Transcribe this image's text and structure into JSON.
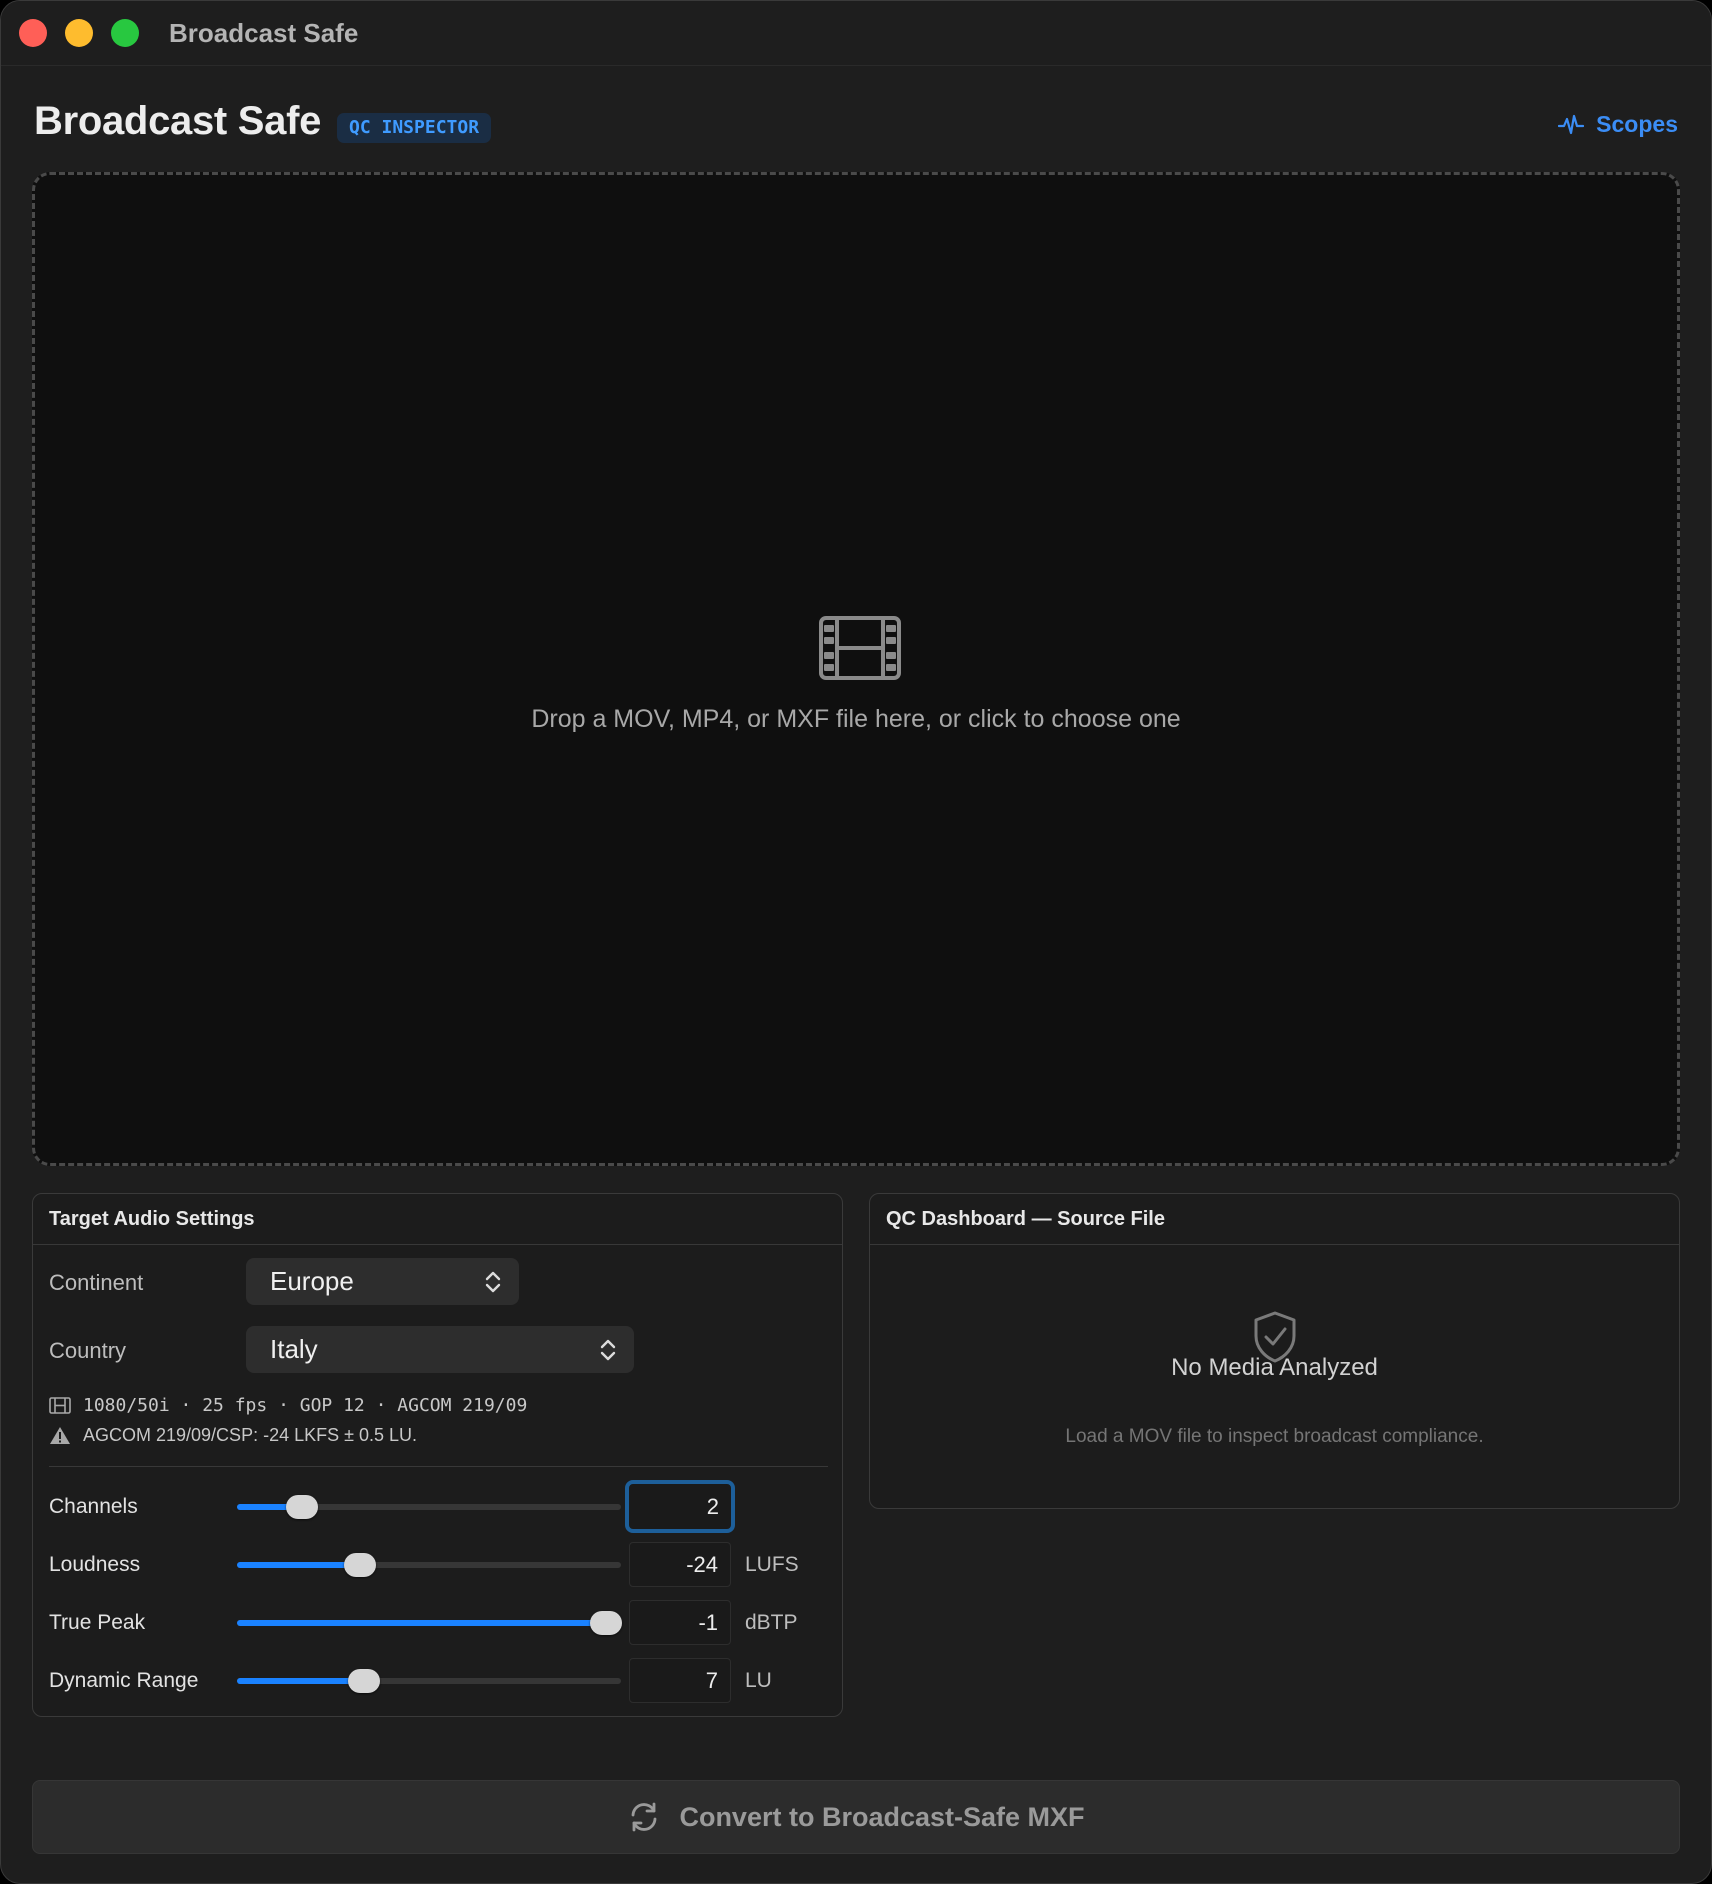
{
  "window": {
    "title": "Broadcast Safe"
  },
  "header": {
    "app_title": "Broadcast Safe",
    "badge": "QC INSPECTOR",
    "scopes_label": "Scopes"
  },
  "dropzone": {
    "icon": "film-icon",
    "text": "Drop a MOV, MP4, or MXF file here, or click to choose one"
  },
  "audio_settings": {
    "title": "Target Audio Settings",
    "continent": {
      "label": "Continent",
      "value": "Europe"
    },
    "country": {
      "label": "Country",
      "value": "Italy"
    },
    "format_line": "1080/50i · 25 fps · GOP 12 · AGCOM 219/09",
    "standard_line": "AGCOM 219/09/CSP: -24 LKFS ± 0.5 LU.",
    "sliders": [
      {
        "label": "Channels",
        "value": "2",
        "unit": "",
        "fill": 0.17
      },
      {
        "label": "Loudness",
        "value": "-24",
        "unit": "LUFS",
        "fill": 0.32
      },
      {
        "label": "True Peak",
        "value": "-1",
        "unit": "dBTP",
        "fill": 0.96
      },
      {
        "label": "Dynamic Range",
        "value": "7",
        "unit": "LU",
        "fill": 0.33
      }
    ]
  },
  "qc_dashboard": {
    "title": "QC Dashboard — Source File",
    "empty_title": "No Media Analyzed",
    "empty_subtitle": "Load a MOV file to inspect broadcast compliance."
  },
  "convert_button": {
    "label": "Convert to Broadcast-Safe MXF"
  },
  "colors": {
    "accent": "#1a82ff",
    "badge_text": "#3f9bff",
    "close": "#ff5f57",
    "minimize": "#febc2e",
    "zoom": "#28c840"
  }
}
